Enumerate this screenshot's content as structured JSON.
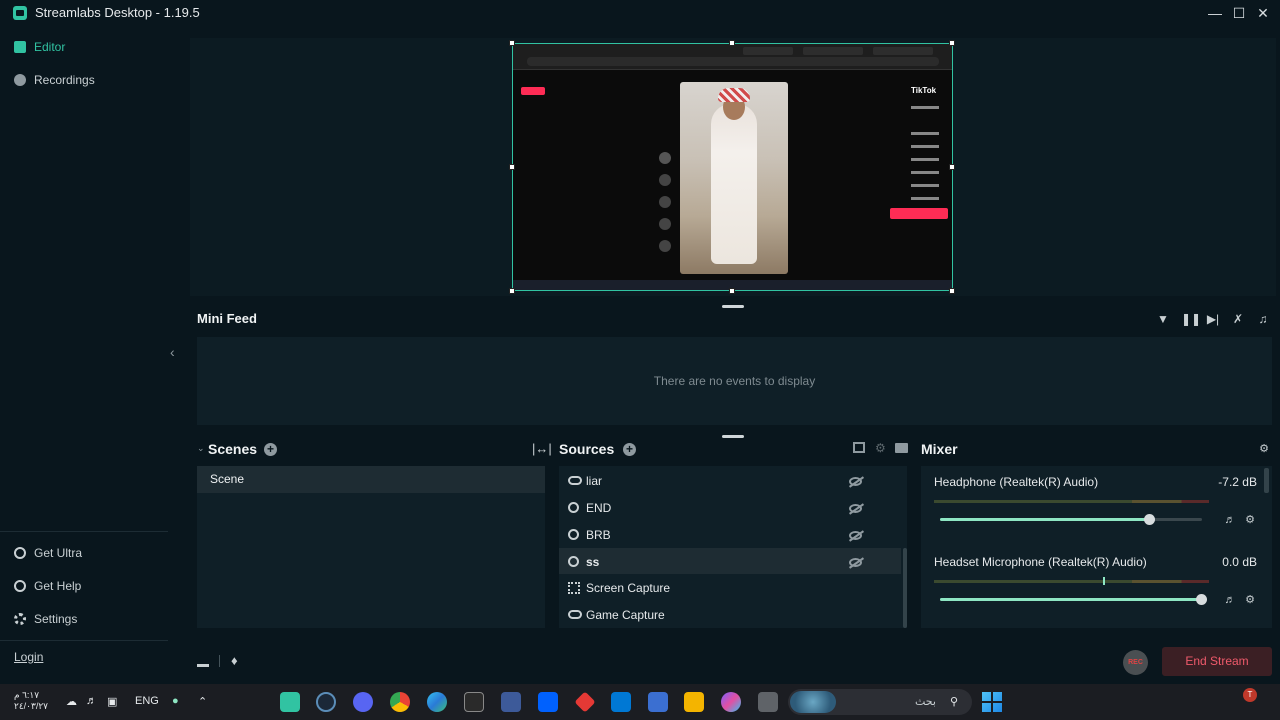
{
  "window": {
    "title": "Streamlabs Desktop - 1.19.5"
  },
  "sidebar": {
    "items": [
      {
        "label": "Editor"
      },
      {
        "label": "Recordings"
      }
    ],
    "bottom": [
      {
        "label": "Get Ultra"
      },
      {
        "label": "Get Help"
      },
      {
        "label": "Settings"
      }
    ],
    "login": "Login"
  },
  "minifeed": {
    "title": "Mini Feed",
    "empty": "There are no events to display"
  },
  "scenes": {
    "title": "Scenes",
    "items": [
      "Scene"
    ]
  },
  "sources": {
    "title": "Sources",
    "items": [
      {
        "label": "liar",
        "icon": "gamepad-icon"
      },
      {
        "label": "END",
        "icon": "globe-icon"
      },
      {
        "label": "BRB",
        "icon": "globe-icon"
      },
      {
        "label": "ss",
        "icon": "globe-icon"
      },
      {
        "label": "Screen Capture",
        "icon": "screen-capture-icon"
      },
      {
        "label": "Game Capture",
        "icon": "gamepad-icon"
      }
    ]
  },
  "mixer": {
    "title": "Mixer",
    "channels": [
      {
        "name": "Headphone (Realtek(R) Audio)",
        "db": "-7.2 dB",
        "level": 0.8
      },
      {
        "name": "Headset Microphone (Realtek(R) Audio)",
        "db": "0.0 dB",
        "level": 1.0
      }
    ]
  },
  "footer": {
    "rec_label": "REC",
    "end_stream": "End Stream"
  },
  "taskbar": {
    "time": "٦:١٧ م",
    "date": "٢٤/٠٣/٢٧",
    "lang": "ENG",
    "search_placeholder": "بحث",
    "notification_badge": "T"
  },
  "preview": {
    "tiktok_label": "TikTok"
  },
  "colors": {
    "accent": "#31c3a2",
    "end_stream": "#ef5a6b"
  }
}
